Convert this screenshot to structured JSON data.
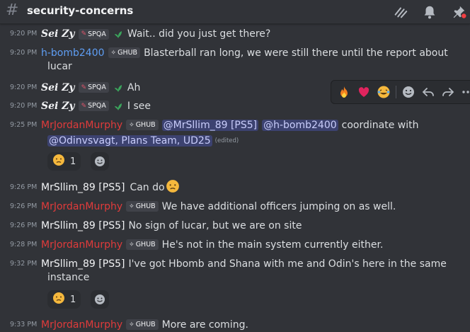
{
  "channel": {
    "name": "security-concerns"
  },
  "header_icons": [
    "threads-icon",
    "bell-icon",
    "pin-icon"
  ],
  "tags": {
    "spqa": "SPQA",
    "ghub": "GHUB"
  },
  "messages": [
    {
      "time": "9:20 PM",
      "user": "Sei Zy",
      "text": "Wait.. did you just get there?"
    },
    {
      "time": "9:20 PM",
      "user": "h-bomb2400",
      "text": "Blasterball ran long, we were still there until the report about",
      "text2": "lucar"
    },
    {
      "time": "9:20 PM",
      "user": "Sei Zy",
      "text": "Ah"
    },
    {
      "time": "9:20 PM",
      "user": "Sei Zy",
      "text": "I see"
    },
    {
      "time": "9:25 PM",
      "user": "MrJordanMurphy",
      "mention1": "@MrSllim_89 [PS5]",
      "mention2": "@h-bomb2400",
      "text": "coordinate with",
      "mention3": "@Odinvsvagt, Plans Team, UD25",
      "edited": "(edited)",
      "reaction_count": "1"
    },
    {
      "time": "9:26 PM",
      "user": "MrSllim_89 [PS5]",
      "text": "Can do"
    },
    {
      "time": "9:26 PM",
      "user": "MrJordanMurphy",
      "text": "We have additional officers jumping on as well."
    },
    {
      "time": "9:26 PM",
      "user": "MrSllim_89 [PS5]",
      "text": "No sign of lucar, but we are on site"
    },
    {
      "time": "9:28 PM",
      "user": "MrJordanMurphy",
      "text": "He's not in the main system currently either."
    },
    {
      "time": "9:32 PM",
      "user": "MrSllim_89 [PS5]",
      "text": "I've got Hbomb and Shana with me and Odin's here in the same",
      "text2": "instance",
      "reaction_count": "1"
    },
    {
      "time": "9:33 PM",
      "user": "MrJordanMurphy",
      "text": "More are coming."
    }
  ],
  "hover_toolbar": [
    "fire-emoji",
    "heart-emoji",
    "laughing-emoji",
    "add-reaction-icon",
    "reply-icon",
    "forward-icon",
    "more-icon"
  ],
  "colors": {
    "background": "#313338",
    "mention": "#3c4270",
    "red_user": "#e03b3b",
    "blue_user": "#5f9ef4"
  }
}
